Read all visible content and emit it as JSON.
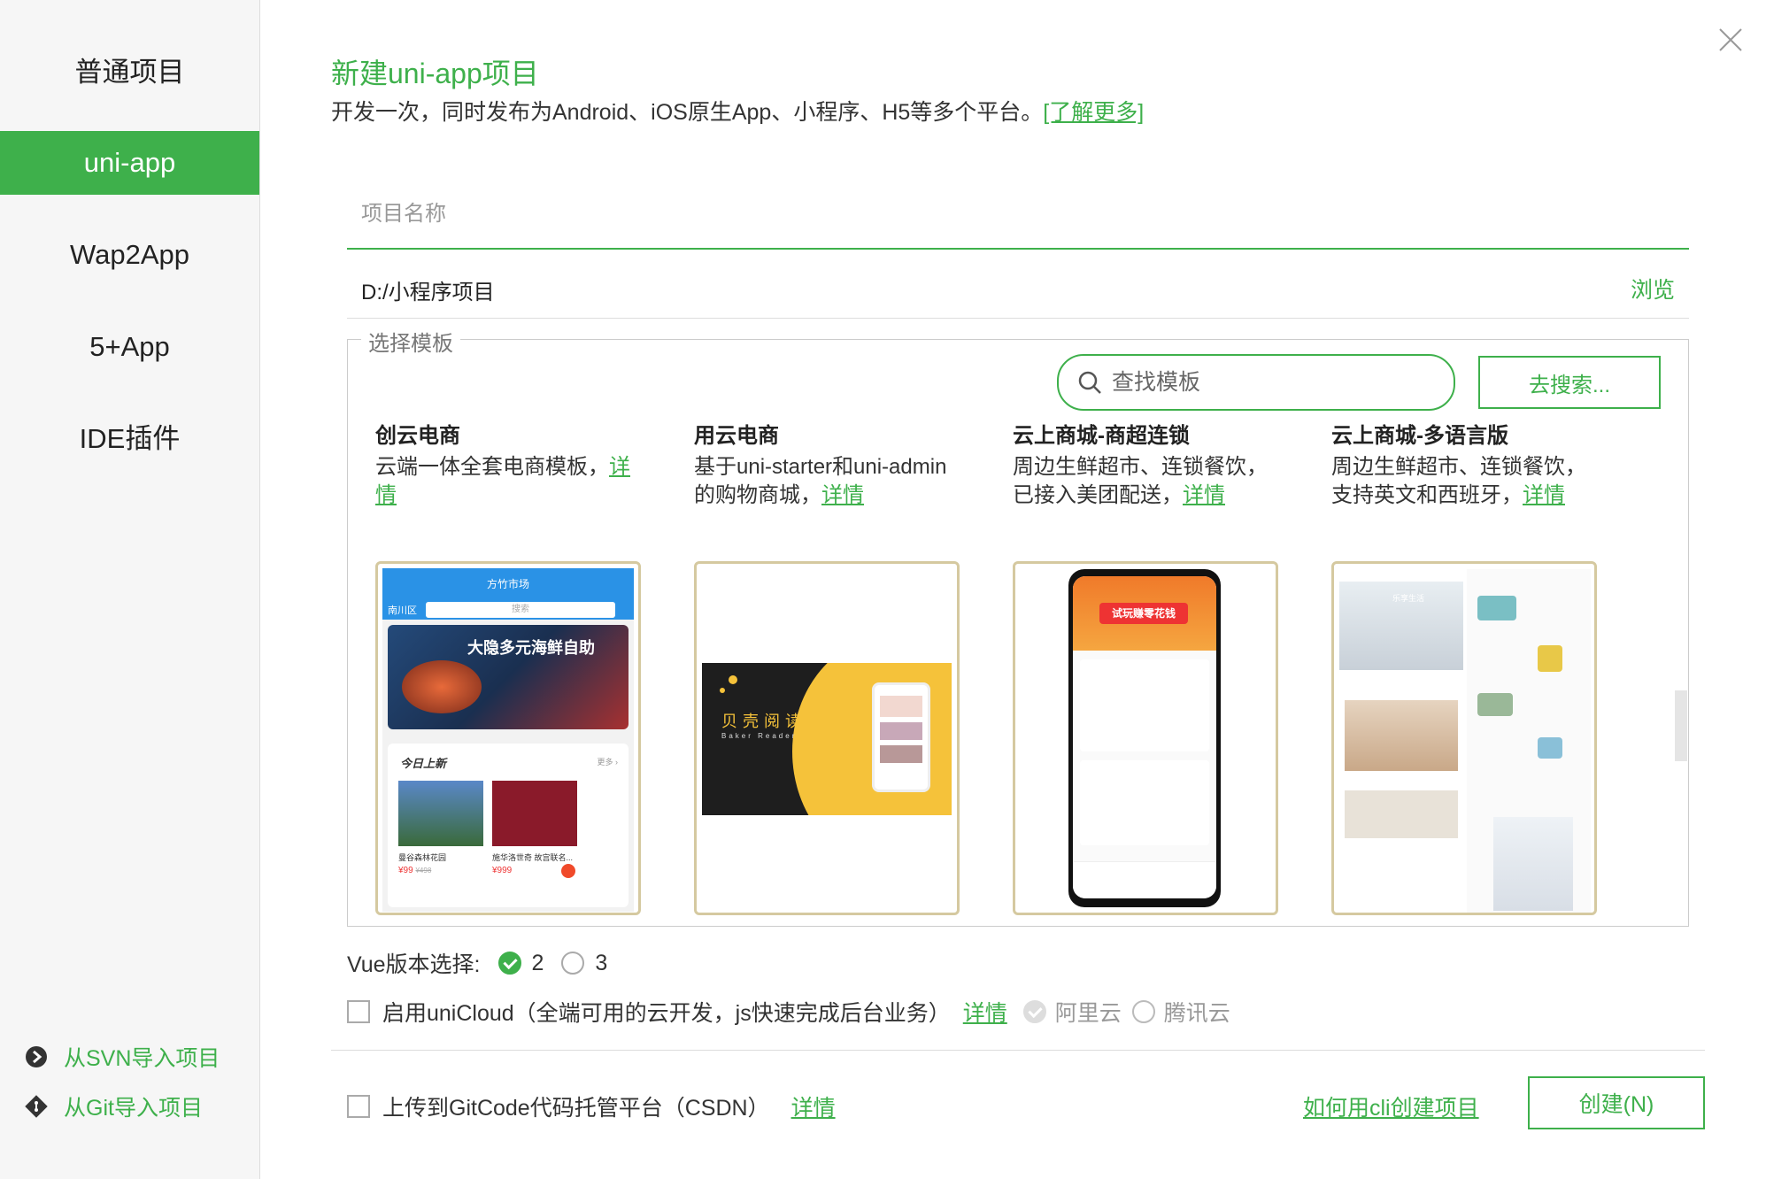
{
  "sidebar": {
    "items": [
      {
        "label": "普通项目"
      },
      {
        "label": "uni-app"
      },
      {
        "label": "Wap2App"
      },
      {
        "label": "5+App"
      },
      {
        "label": "IDE插件"
      }
    ],
    "import_svn": "从SVN导入项目",
    "import_git": "从Git导入项目"
  },
  "header": {
    "title": "新建uni-app项目",
    "subtitle": "开发一次，同时发布为Android、iOS原生App、小程序、H5等多个平台。",
    "learn_more": "[了解更多]"
  },
  "form": {
    "project_name_placeholder": "项目名称",
    "project_name_value": "",
    "path": "D:/小程序项目",
    "browse": "浏览"
  },
  "templates": {
    "legend": "选择模板",
    "search_placeholder": "查找模板",
    "search_button": "去搜索...",
    "cards": [
      {
        "title": "创云电商",
        "desc": "云端一体全套电商模板，",
        "detail": "详情"
      },
      {
        "title": "用云电商",
        "desc": "基于uni-starter和uni-admin的购物商城，",
        "detail": "详情"
      },
      {
        "title": "云上商城-商超连锁",
        "desc": "周边生鲜超市、连锁餐饮，已接入美团配送，",
        "detail": "详情"
      },
      {
        "title": "云上商城-多语言版",
        "desc": "周边生鲜超市、连锁餐饮，支持英文和西班牙，",
        "detail": "详情"
      }
    ],
    "previews": {
      "shop1": {
        "header": "方竹市场",
        "region": "南川区",
        "search": "搜索",
        "banner": "大隐多元海鲜自助",
        "today": "今日上新",
        "more": "更多 ›",
        "item1": "曼谷森林花园",
        "price1": "¥99",
        "old_price1": "¥498",
        "item2": "施华洛世奇 故宫联名...",
        "price2": "¥999"
      },
      "reader": {
        "name": "贝壳阅读",
        "english": "Baker Reader"
      },
      "chain": {
        "banner": "试玩赚零花钱"
      },
      "multi": {
        "banner": "乐享生活"
      }
    }
  },
  "vue": {
    "label": "Vue版本选择:",
    "option2": "2",
    "option3": "3",
    "selected": "2"
  },
  "unicloud": {
    "label": "启用uniCloud（全端可用的云开发，js快速完成后台业务）",
    "detail": "详情",
    "aliyun": "阿里云",
    "tencent": "腾讯云",
    "checked": false
  },
  "gitcode": {
    "label": "上传到GitCode代码托管平台（CSDN）",
    "detail": "详情",
    "checked": false
  },
  "footer": {
    "cli_link": "如何用cli创建项目",
    "create_button": "创建(N)"
  },
  "colors": {
    "accent": "#3eb04b",
    "card_border": "#d5c9a0"
  }
}
